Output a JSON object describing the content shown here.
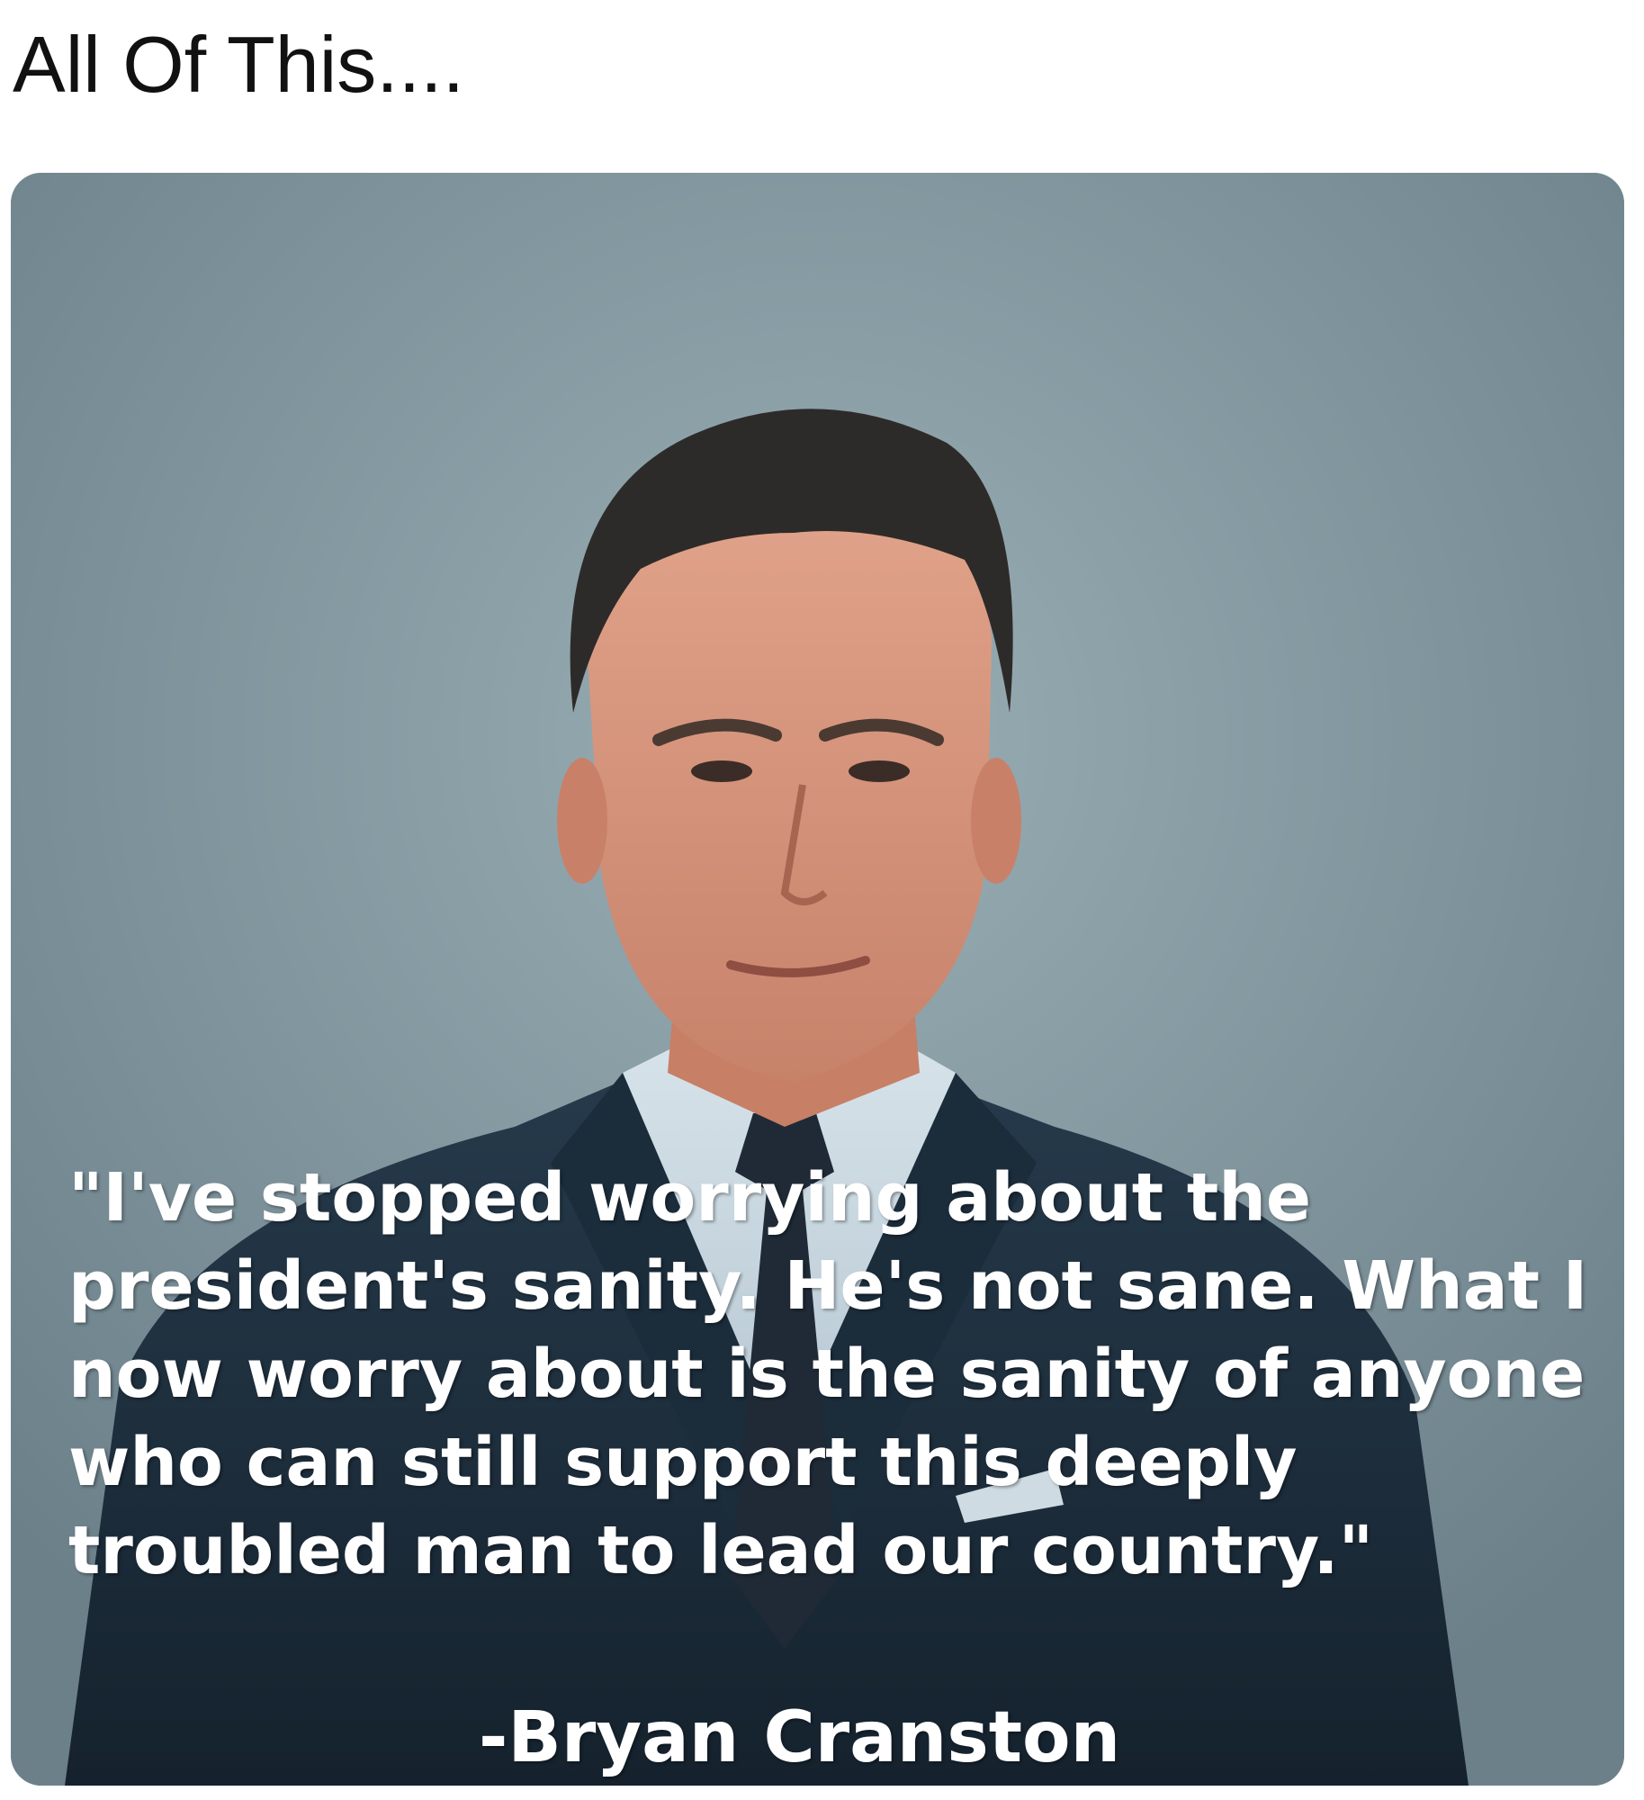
{
  "post": {
    "caption": "All Of This...."
  },
  "image": {
    "subject_icon": "person-portrait-icon",
    "background_color": "#7e939c",
    "suit_color": "#1d2f3f",
    "quote_lines": [
      "\"I've stopped worrying about the",
      "president's sanity. He's not sane. What I",
      "now worry about is the sanity of anyone",
      "who can still support this deeply",
      "troubled man to lead our country.\""
    ],
    "attribution": "-Bryan Cranston"
  }
}
